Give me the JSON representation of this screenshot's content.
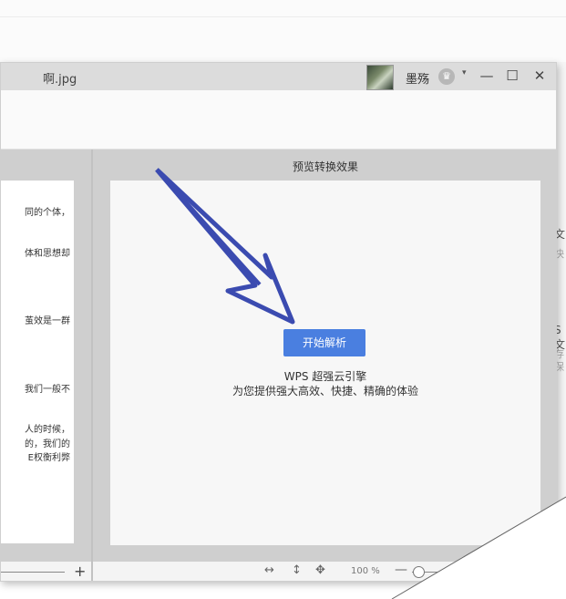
{
  "window": {
    "title": "啊.jpg"
  },
  "user": {
    "name": "墨殇",
    "vip_icon": "vip-crown-icon",
    "dropdown": "▾"
  },
  "window_controls": {
    "minimize": "—",
    "maximize": "☐",
    "close": "✕"
  },
  "left_preview": {
    "lines": [
      "同的个体，",
      "体和思想却",
      "茧效是一群",
      "我们一般不",
      "人的时候，",
      "的，我们的",
      "E权衡利弊"
    ]
  },
  "background_fragments": [
    "文",
    "快",
    "S文",
    "存",
    "保"
  ],
  "right_preview": {
    "title": "预览转换效果",
    "start_button": "开始解析",
    "engine_name": "WPS 超强云引擎",
    "engine_desc": "为您提供强大高效、快捷、精确的体验"
  },
  "status_bar": {
    "left_plus": "+",
    "fit_width_icon": "↔",
    "fit_height_icon": "↕",
    "move_icon": "✥",
    "zoom_text": "100 %",
    "zoom_minus": "—"
  },
  "colors": {
    "accent": "#4a7fe0",
    "arrow": "#3b4bb0"
  }
}
